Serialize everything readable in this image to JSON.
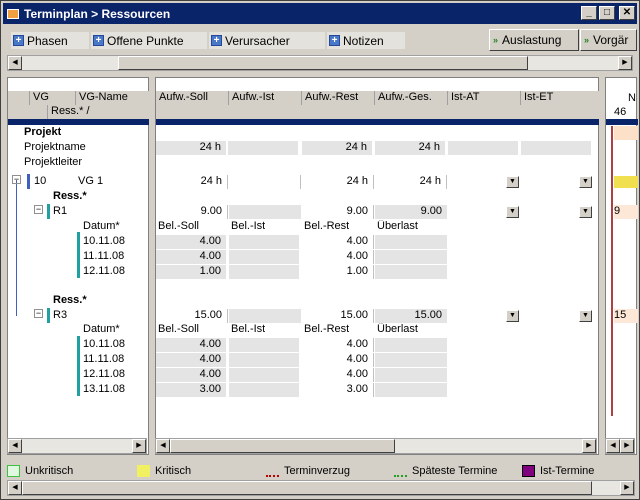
{
  "window": {
    "title": "Terminplan > Ressourcen"
  },
  "toolbar": {
    "tabs": [
      {
        "label": "Phasen"
      },
      {
        "label": "Offene Punkte"
      },
      {
        "label": "Verursacher"
      },
      {
        "label": "Notizen"
      }
    ],
    "right": [
      {
        "label": "Auslastung"
      },
      {
        "label": "Vorgär"
      }
    ]
  },
  "grid": {
    "header_row1": [
      "VG",
      "VG-Name",
      "Aufw.-Soll",
      "Aufw.-Ist",
      "Aufw.-Rest",
      "Aufw.-Ges.",
      "Ist-AT",
      "Ist-ET"
    ],
    "header_row2": {
      "ress": "Ress.* /"
    },
    "section_projekt": "Projekt",
    "projekt_rows": [
      {
        "label": "Projektname",
        "soll": "24 h",
        "rest": "24 h",
        "ges": "24 h"
      },
      {
        "label": "Projektleiter"
      }
    ],
    "vg": {
      "id": "10",
      "name": "VG 1",
      "soll": "24 h",
      "rest": "24 h",
      "ges": "24 h"
    },
    "ress_label": "Ress.*",
    "bel_headers": [
      "Datum*",
      "Bel.-Soll",
      "Bel.-Ist",
      "Bel.-Rest",
      "Überlast"
    ],
    "resources": [
      {
        "name": "R1",
        "soll": "9.00",
        "rest": "9.00",
        "ges": "9.00",
        "gantt": "9",
        "rows": [
          {
            "date": "10.11.08",
            "soll": "4.00",
            "rest": "4.00"
          },
          {
            "date": "11.11.08",
            "soll": "4.00",
            "rest": "4.00"
          },
          {
            "date": "12.11.08",
            "soll": "1.00",
            "rest": "1.00"
          }
        ]
      },
      {
        "name": "R3",
        "soll": "15.00",
        "rest": "15.00",
        "ges": "15.00",
        "gantt": "15",
        "rows": [
          {
            "date": "10.11.08",
            "soll": "4.00",
            "rest": "4.00"
          },
          {
            "date": "11.11.08",
            "soll": "4.00",
            "rest": "4.00"
          },
          {
            "date": "12.11.08",
            "soll": "4.00",
            "rest": "4.00"
          },
          {
            "date": "13.11.08",
            "soll": "3.00",
            "rest": "3.00"
          }
        ]
      }
    ]
  },
  "gantt": {
    "header_top": "N",
    "header_week": "46"
  },
  "legend": [
    {
      "label": "Unkritisch",
      "color": "#e0f8e0",
      "border": "#40c040"
    },
    {
      "label": "Kritisch",
      "color": "#f0f060",
      "border": "#f0f060"
    },
    {
      "label": "Terminverzug",
      "color": "#c00000"
    },
    {
      "label": "Späteste Termine",
      "color": "#20a020"
    },
    {
      "label": "Ist-Termine",
      "color": "#800080"
    }
  ],
  "colors": {
    "titlebar": "#0a246a",
    "selection": "#0a246a",
    "kritisch": "#f0e050",
    "tealbar": "#20a0a0"
  }
}
